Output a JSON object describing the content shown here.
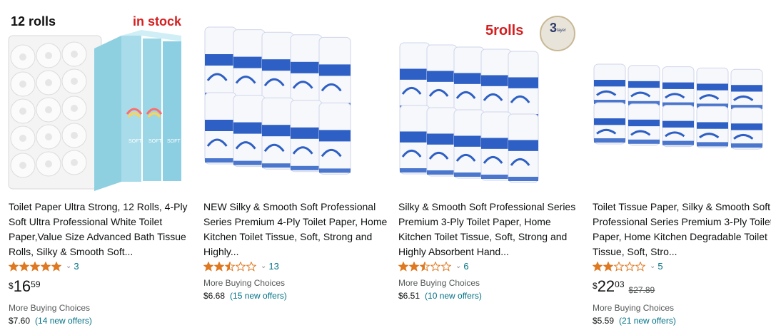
{
  "products": [
    {
      "title": "Toilet Paper Ultra Strong, 12 Rolls, 4-Ply Soft Ultra Professional White Toilet Paper,Value Size Advanced Bath Tissue Rolls, Silky & Smooth Soft...",
      "rating": 5.0,
      "review_count": "3",
      "price": {
        "currency": "$",
        "whole": "16",
        "fraction": "59",
        "list_price": ""
      },
      "more_buying_label": "More Buying Choices",
      "more_buying_price": "$7.60",
      "offers": "(14 new offers)",
      "image_overlay": {
        "left_text": "12 rolls",
        "right_text": "in stock"
      }
    },
    {
      "title": "NEW Silky & Smooth Soft Professional Series Premium 4-Ply Toilet Paper, Home Kitchen Toilet Tissue, Soft, Strong and Highly...",
      "rating": 2.5,
      "review_count": "13",
      "more_buying_label": "More Buying Choices",
      "more_buying_price": "$6.68",
      "offers": "(15 new offers)",
      "image_overlay": {
        "left_text": "",
        "right_text": ""
      }
    },
    {
      "title": "Silky & Smooth Soft Professional Series Premium 3-Ply Toilet Paper, Home Kitchen Toilet Tissue, Soft, Strong and Highly Absorbent Hand...",
      "rating": 2.5,
      "review_count": "6",
      "more_buying_label": "More Buying Choices",
      "more_buying_price": "$6.51",
      "offers": "(10 new offers)",
      "image_overlay": {
        "left_text": "5rolls",
        "badge_number": "3",
        "badge_text": "layer"
      }
    },
    {
      "title": "Toilet Tissue Paper, Silky & Smooth Soft Professional Series Premium 3-Ply Toilet Paper, Home Kitchen Degradable Toilet Tissue, Soft, Stro...",
      "rating": 2.0,
      "review_count": "5",
      "price": {
        "currency": "$",
        "whole": "22",
        "fraction": "03",
        "list_price": "$27.89"
      },
      "more_buying_label": "More Buying Choices",
      "more_buying_price": "$5.59",
      "offers": "(21 new offers)"
    }
  ],
  "colors": {
    "star": "#de7921",
    "link": "#007185",
    "overlay_red": "#d42020",
    "roll_blue": "#2d5fc4"
  },
  "icons": {
    "rating": "star-icon",
    "expand": "chevron-down-icon"
  }
}
